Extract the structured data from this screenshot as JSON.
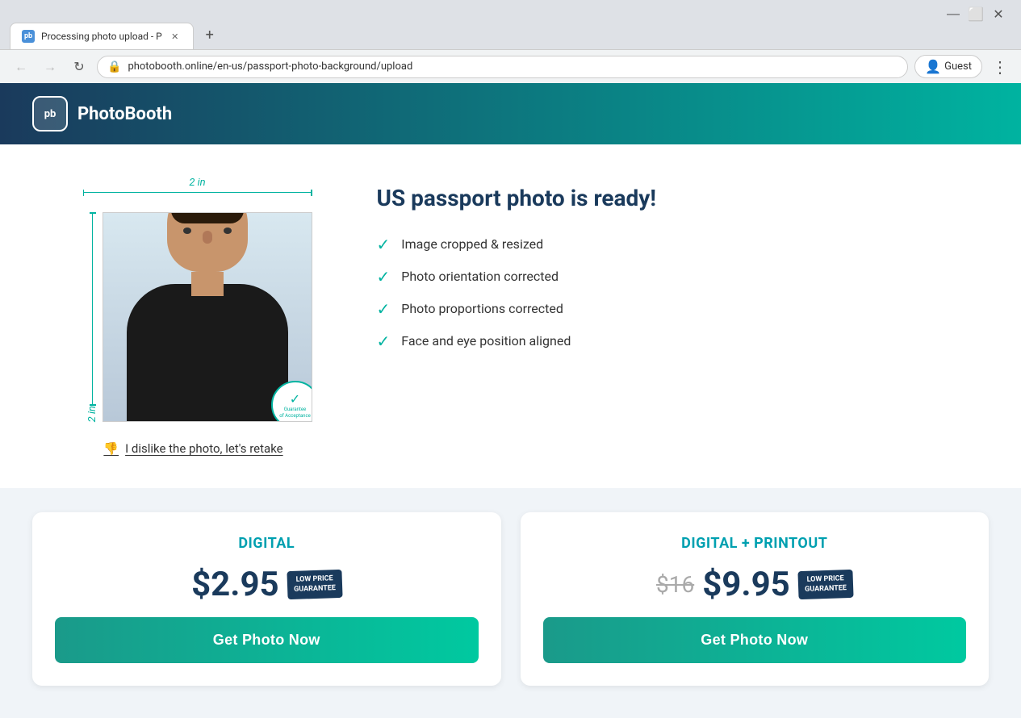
{
  "browser": {
    "tab_title": "Processing photo upload - P",
    "tab_favicon": "pb",
    "url": "photobooth.online/en-us/passport-photo-background/upload",
    "new_tab_label": "+",
    "profile_label": "Guest",
    "min_btn": "—",
    "max_btn": "⬜",
    "close_btn": "✕"
  },
  "header": {
    "logo_icon": "pb",
    "logo_text": "PhotoBooth"
  },
  "photo_section": {
    "dim_top": "2 in",
    "dim_side": "2 in",
    "guarantee_top": "Guarantee",
    "guarantee_bottom": "of Acceptance",
    "guarantee_check": "✓",
    "retake_label": "I dislike the photo, let's retake"
  },
  "info_section": {
    "title": "US passport photo is ready!",
    "checklist": [
      {
        "label": "Image cropped & resized"
      },
      {
        "label": "Photo orientation corrected"
      },
      {
        "label": "Photo proportions corrected"
      },
      {
        "label": "Face and eye position aligned"
      }
    ]
  },
  "pricing": {
    "cards": [
      {
        "id": "digital",
        "title": "DIGITAL",
        "price": "$2.95",
        "price_old": null,
        "badge_line1": "LOW PRICE",
        "badge_line2": "GUARANTEE",
        "btn_label": "Get Photo Now"
      },
      {
        "id": "digital-printout",
        "title": "DIGITAL + PRINTOUT",
        "price": "$9.95",
        "price_old": "$16",
        "badge_line1": "LOW PRICE",
        "badge_line2": "GUARANTEE",
        "btn_label": "Get Photo Now"
      }
    ]
  }
}
